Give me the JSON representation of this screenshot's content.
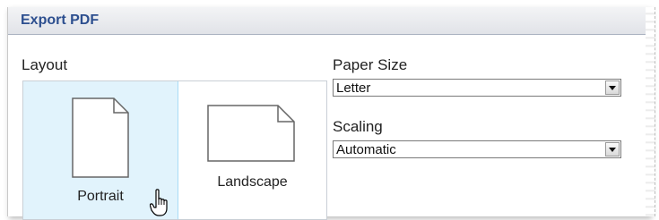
{
  "dialog": {
    "title": "Export PDF"
  },
  "layout": {
    "label": "Layout",
    "selected": "Portrait",
    "options": [
      {
        "label": "Portrait",
        "icon": "portrait-page-icon"
      },
      {
        "label": "Landscape",
        "icon": "landscape-page-icon"
      }
    ]
  },
  "paper_size": {
    "label": "Paper Size",
    "value": "Letter"
  },
  "scaling": {
    "label": "Scaling",
    "value": "Automatic"
  },
  "colors": {
    "title_text": "#2d4f8f",
    "selected_bg": "#e1f3fc",
    "selected_border": "#a9dcf6"
  },
  "cursor": "hand-pointer-icon"
}
